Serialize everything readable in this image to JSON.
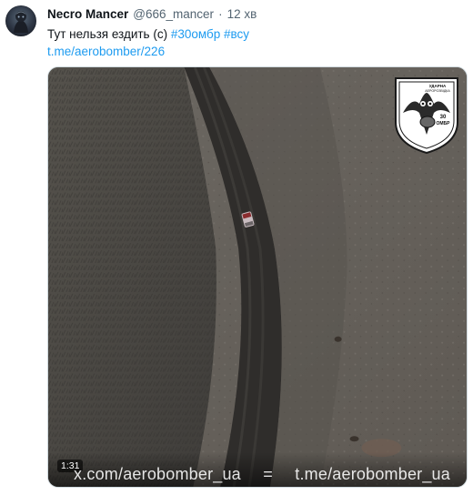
{
  "tweet": {
    "author_name": "Necro Mancer",
    "author_handle": "@666_mancer",
    "separator": "·",
    "timestamp": "12 хв",
    "text_plain": "Тут нельзя ездить (с) ",
    "hashtags": [
      "#30омбр",
      "#всу"
    ],
    "link": "t.me/aerobomber/226"
  },
  "media": {
    "type": "video",
    "duration": "1:31",
    "watermark_left": "x.com/aerobomber_ua",
    "watermark_sep": "=",
    "watermark_right": "t.me/aerobomber_ua",
    "badge_lines": [
      "УДАРНА",
      "АЕРОРОЗВІДКА",
      "30",
      "ОМБР"
    ]
  },
  "icons": {
    "avatar": "profile-avatar",
    "badge": "unit-emblem-owl-shield"
  }
}
